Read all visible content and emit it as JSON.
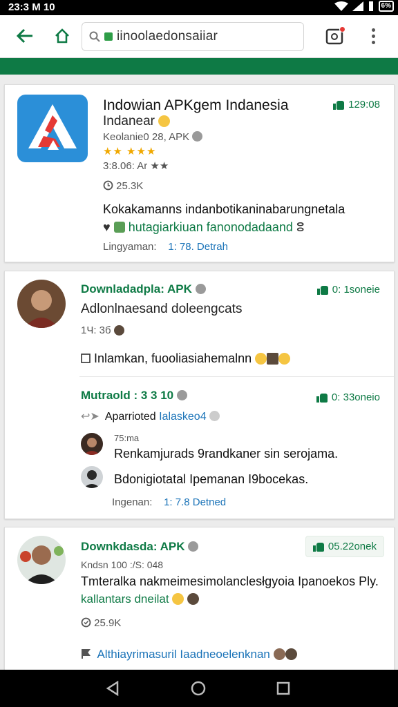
{
  "status_bar": {
    "time": "23:3 M 10",
    "battery": "6%"
  },
  "browser": {
    "url": "iinoolaedonsaiiar"
  },
  "card1": {
    "title": "Indowian APKgem Indanesia",
    "subtitle": "Indanear",
    "meta": "Keolanie0 28, APK",
    "stars": "★★  ★★★",
    "version": "3:8.06: Ar ★★",
    "views": "25.3K",
    "likes": "129:08",
    "desc_line1": "Kokakamanns indanbotikaninabarungnetala",
    "desc_line2": "hutagiarkiuan fanonodadaand",
    "footer_label": "Lingyaman:",
    "footer_link": "1: 78. Detrah"
  },
  "card2": {
    "author": "Downladadpla: APK",
    "likes": "0: 1soneie",
    "title": "Adlonlnaesand doleengcats",
    "time": "1Ч: 3б",
    "post": "Inlamkan, fuooliasiahemalnn",
    "reply_author": "Mutraold : 3 3 10",
    "reply_likes": "0: 33oneio",
    "reply_text": "Aparrioted",
    "reply_link": "Ialaskeo4",
    "comment1_meta": "75:ma",
    "comment1_text": "Renkamjurads 9randkaner sin serojama.",
    "comment2_text": "Bdonigiotatal Ipemanan I9bocekas.",
    "footer_label": "Ingenan:",
    "footer_link": "1: 7.8 Detned"
  },
  "card3": {
    "author": "Downkdasda: APK",
    "likes": "05.22onek",
    "meta": "Kndsn 100 :/S: 048",
    "text": "Tmteralka nakmeimesimolanclesłgyoia Ipanoekos Ply.",
    "tag": "kallantars dneilat",
    "views": "25.9K",
    "footer_link": "Althiayrimasuril Iaadneoelenknan"
  },
  "colors": {
    "accent": "#0e7a45",
    "link": "#1a73b8",
    "app_icon": "#2b8fd8"
  },
  "icons": [
    "back-arrow-icon",
    "home-icon",
    "search-icon",
    "lock-icon",
    "tabs-icon",
    "menu-icon",
    "thumb-up-icon",
    "clock-icon",
    "back-nav-icon",
    "home-nav-icon",
    "recents-nav-icon"
  ]
}
